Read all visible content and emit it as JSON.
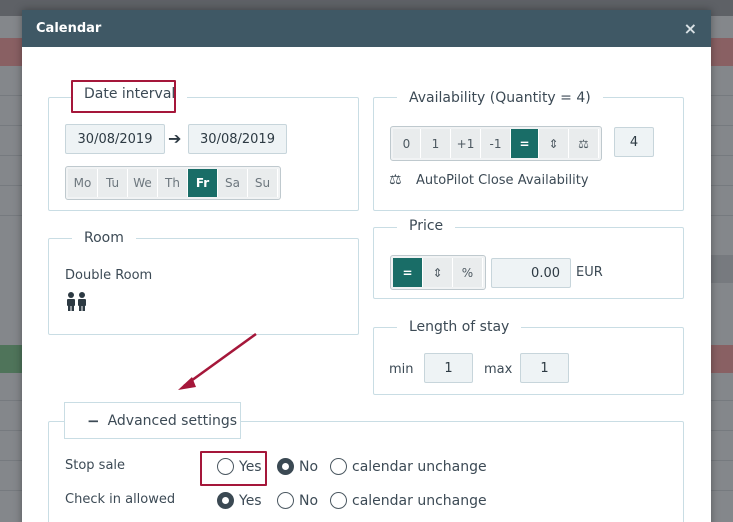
{
  "modal": {
    "title": "Calendar",
    "close_symbol": "×"
  },
  "date_interval": {
    "legend": "Date interval",
    "from": "30/08/2019",
    "to": "30/08/2019",
    "days": [
      {
        "label": "Mo",
        "active": false
      },
      {
        "label": "Tu",
        "active": false
      },
      {
        "label": "We",
        "active": false
      },
      {
        "label": "Th",
        "active": false
      },
      {
        "label": "Fr",
        "active": true
      },
      {
        "label": "Sa",
        "active": false
      },
      {
        "label": "Su",
        "active": false
      }
    ]
  },
  "availability": {
    "legend": "Availability (Quantity = 4)",
    "buttons": [
      "0",
      "1",
      "+1",
      "-1",
      "=",
      "⇕",
      "⚖"
    ],
    "active_index": 4,
    "value": "4",
    "autopilot_label": "AutoPilot Close Availability"
  },
  "room": {
    "legend": "Room",
    "name": "Double Room"
  },
  "price": {
    "legend": "Price",
    "buttons": [
      "=",
      "⇕",
      "%"
    ],
    "active_index": 0,
    "value": "0.00",
    "currency": "EUR"
  },
  "length_of_stay": {
    "legend": "Length of stay",
    "min_label": "min",
    "min_value": "1",
    "max_label": "max",
    "max_value": "1"
  },
  "advanced": {
    "toggle_symbol": "−",
    "label": "Advanced settings",
    "stop_sale": {
      "label": "Stop sale",
      "options": [
        "Yes",
        "No",
        "calendar unchange"
      ],
      "selected": 1
    },
    "check_in": {
      "label": "Check in allowed",
      "options": [
        "Yes",
        "No",
        "calendar unchange"
      ],
      "selected": 0
    }
  },
  "colors": {
    "header": "#3f5865",
    "accent": "#196d67",
    "highlight": "#a5173a",
    "link": "#1f8c82"
  }
}
